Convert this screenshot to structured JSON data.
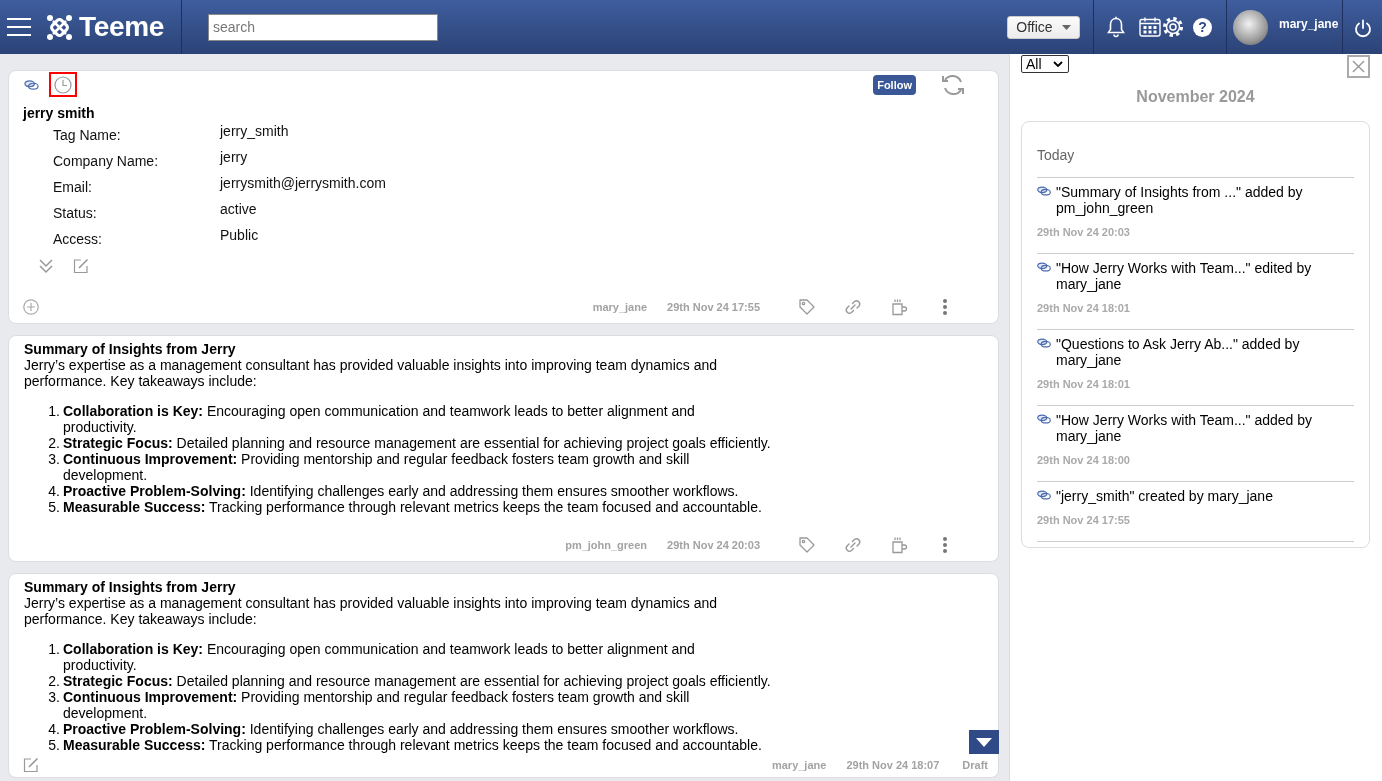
{
  "header": {
    "app_name": "Teeme",
    "search": {
      "placeholder": "search"
    },
    "workspace": "Office",
    "help_label": "?",
    "user": {
      "name": "mary_jane"
    }
  },
  "cards": [
    {
      "kind": "profile",
      "history_selected": true,
      "follow_label": "Follow",
      "title": "jerry smith",
      "fields": [
        {
          "label": "Tag Name:",
          "value": "jerry_smith"
        },
        {
          "label": "Company Name:",
          "value": "jerry"
        },
        {
          "label": "Email:",
          "value": "jerrysmith@jerrysmith.com"
        },
        {
          "label": "Status:",
          "value": "active"
        },
        {
          "label": "Access:",
          "value": "Public"
        }
      ],
      "author": "mary_jane",
      "time": "29th Nov 24 17:55"
    },
    {
      "kind": "post",
      "title": "Summary of Insights from Jerry",
      "intro": "Jerry’s expertise as a management consultant has provided valuable insights into improving team dynamics and performance. Key takeaways include:",
      "points": [
        {
          "number": "1.",
          "text": "**Collaboration is Key:** Encouraging open communication and teamwork leads to better alignment and productivity."
        },
        {
          "number": "2.",
          "text": "**Strategic Focus:** Detailed planning and resource management are essential for achieving project goals efficiently."
        },
        {
          "number": "3.",
          "text": "**Continuous Improvement:** Providing mentorship and regular feedback fosters team growth and skill development."
        },
        {
          "number": "4.",
          "text": "**Proactive Problem-Solving:** Identifying challenges early and addressing them ensures smoother workflows."
        },
        {
          "number": "5.",
          "text": "**Measurable Success:** Tracking performance through relevant metrics keeps the team focused and accountable."
        }
      ],
      "author": "pm_john_green",
      "time": "29th Nov 24 20:03"
    },
    {
      "kind": "draft",
      "title": "Summary of Insights from Jerry",
      "intro": "Jerry’s expertise as a management consultant has provided valuable insights into improving team dynamics and performance. Key takeaways include:",
      "points": [
        {
          "number": "1.",
          "text": "**Collaboration is Key:** Encouraging open communication and teamwork leads to better alignment and productivity."
        },
        {
          "number": "2.",
          "text": "**Strategic Focus:** Detailed planning and resource management are essential for achieving project goals efficiently."
        },
        {
          "number": "3.",
          "text": "**Continuous Improvement:** Providing mentorship and regular feedback fosters team growth and skill development."
        },
        {
          "number": "4.",
          "text": "**Proactive Problem-Solving:** Identifying challenges early and addressing them ensures smoother workflows."
        },
        {
          "number": "5.",
          "text": "**Measurable Success:** Tracking performance through relevant metrics keeps the team focused and accountable."
        }
      ],
      "author": "mary_jane",
      "time": "29th Nov 24 18:07",
      "status": "Draft"
    }
  ],
  "activity": {
    "filter": "All",
    "month": "November 2024",
    "group": "Today",
    "entries": [
      {
        "text": "\"Summary of Insights from ...\" added by pm_john_green",
        "time": "29th Nov 24 20:03"
      },
      {
        "text": "\"How Jerry Works with Team...\" edited by mary_jane",
        "time": "29th Nov 24 18:01"
      },
      {
        "text": "\"Questions to Ask Jerry Ab...\" added by mary_jane",
        "time": "29th Nov 24 18:01"
      },
      {
        "text": "\"How Jerry Works with Team...\" added by mary_jane",
        "time": "29th Nov 24 18:00"
      },
      {
        "text": "\"jerry_smith\" created by mary_jane",
        "time": "29th Nov 24 17:55"
      }
    ]
  }
}
